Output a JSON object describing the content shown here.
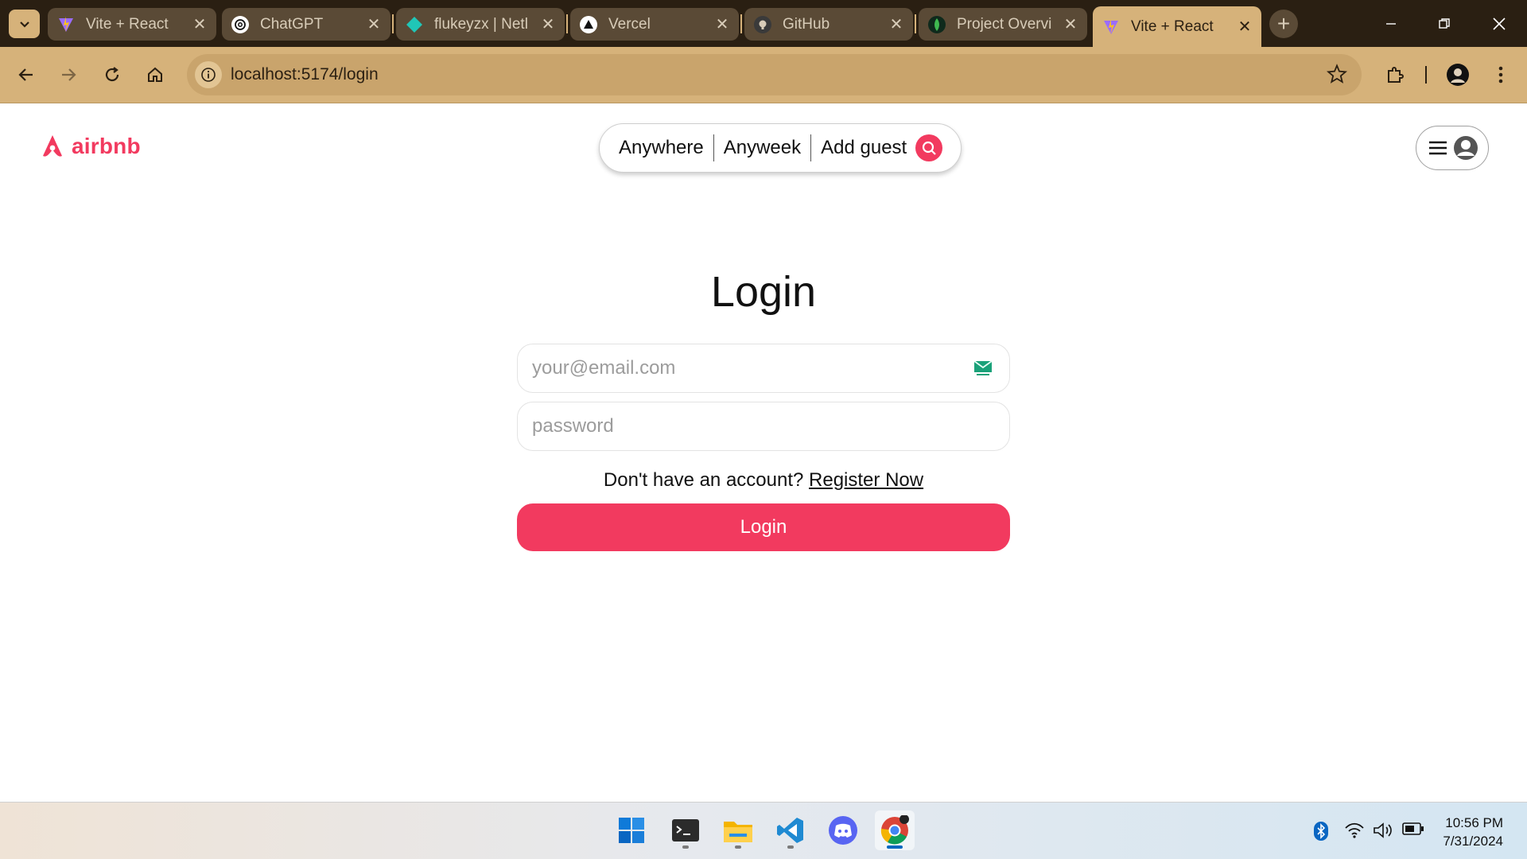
{
  "browser": {
    "tabs": [
      {
        "title": "Vite + React",
        "favicon": "vite-icon",
        "active": false
      },
      {
        "title": "ChatGPT",
        "favicon": "chatgpt-icon",
        "active": false
      },
      {
        "title": "flukeyzx | Netl",
        "favicon": "netlify-icon",
        "active": false
      },
      {
        "title": "Vercel",
        "favicon": "vercel-icon",
        "active": false
      },
      {
        "title": "GitHub",
        "favicon": "github-icon",
        "active": false
      },
      {
        "title": "Project Overvi",
        "favicon": "mongodb-icon",
        "active": false
      },
      {
        "title": "Vite + React",
        "favicon": "vite-icon",
        "active": true
      }
    ],
    "url": "localhost:5174/login",
    "colors": {
      "frame": "#2a1f12",
      "toolbar": "#d6b27a"
    }
  },
  "header": {
    "logo_text": "airbnb",
    "search": {
      "where": "Anywhere",
      "when": "Anyweek",
      "guests": "Add guest"
    }
  },
  "login": {
    "title": "Login",
    "email_placeholder": "your@email.com",
    "password_placeholder": "password",
    "register_prompt": "Don't have an account?",
    "register_link": "Register Now",
    "submit_label": "Login"
  },
  "taskbar": {
    "apps": [
      "windows-start-icon",
      "terminal-icon",
      "file-explorer-icon",
      "vscode-icon",
      "discord-icon",
      "chrome-icon"
    ],
    "tray_icons": [
      "bluetooth-icon",
      "wifi-icon",
      "volume-icon",
      "battery-icon"
    ],
    "time": "10:56 PM",
    "date": "7/31/2024"
  },
  "theme": {
    "brand": "#f23a5f"
  }
}
